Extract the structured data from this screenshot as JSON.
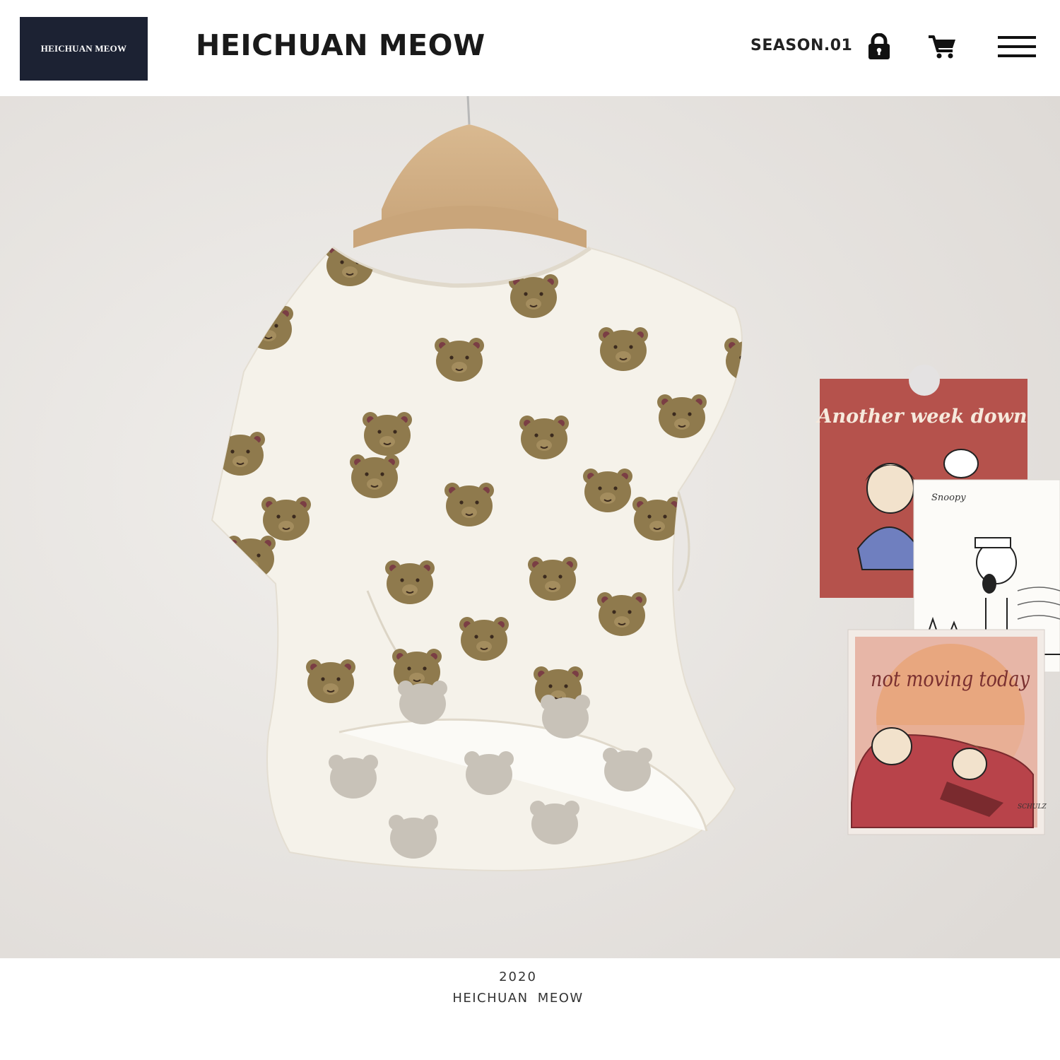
{
  "header": {
    "logo_text": "HEICHUAN MEOW",
    "brand_title": "HEICHUAN MEOW",
    "season_label": "SEASON.01",
    "icons": [
      "lock-icon",
      "cart-icon",
      "menu-icon"
    ]
  },
  "photo": {
    "postcard_1_text": "Another week down",
    "postcard_2_text": "Snoopy",
    "postcard_3_text": "not moving today",
    "postcard_3_signature": "SCHULZ"
  },
  "footer": {
    "year": "2020",
    "brand": "HEICHUAN MEOW"
  },
  "colors": {
    "logo_bg": "#1c2233",
    "bear_brown": "#8f7a4d",
    "bear_ear": "#7a3e44",
    "postcard_red": "#b5524c",
    "wall": "#e9e6e3"
  }
}
